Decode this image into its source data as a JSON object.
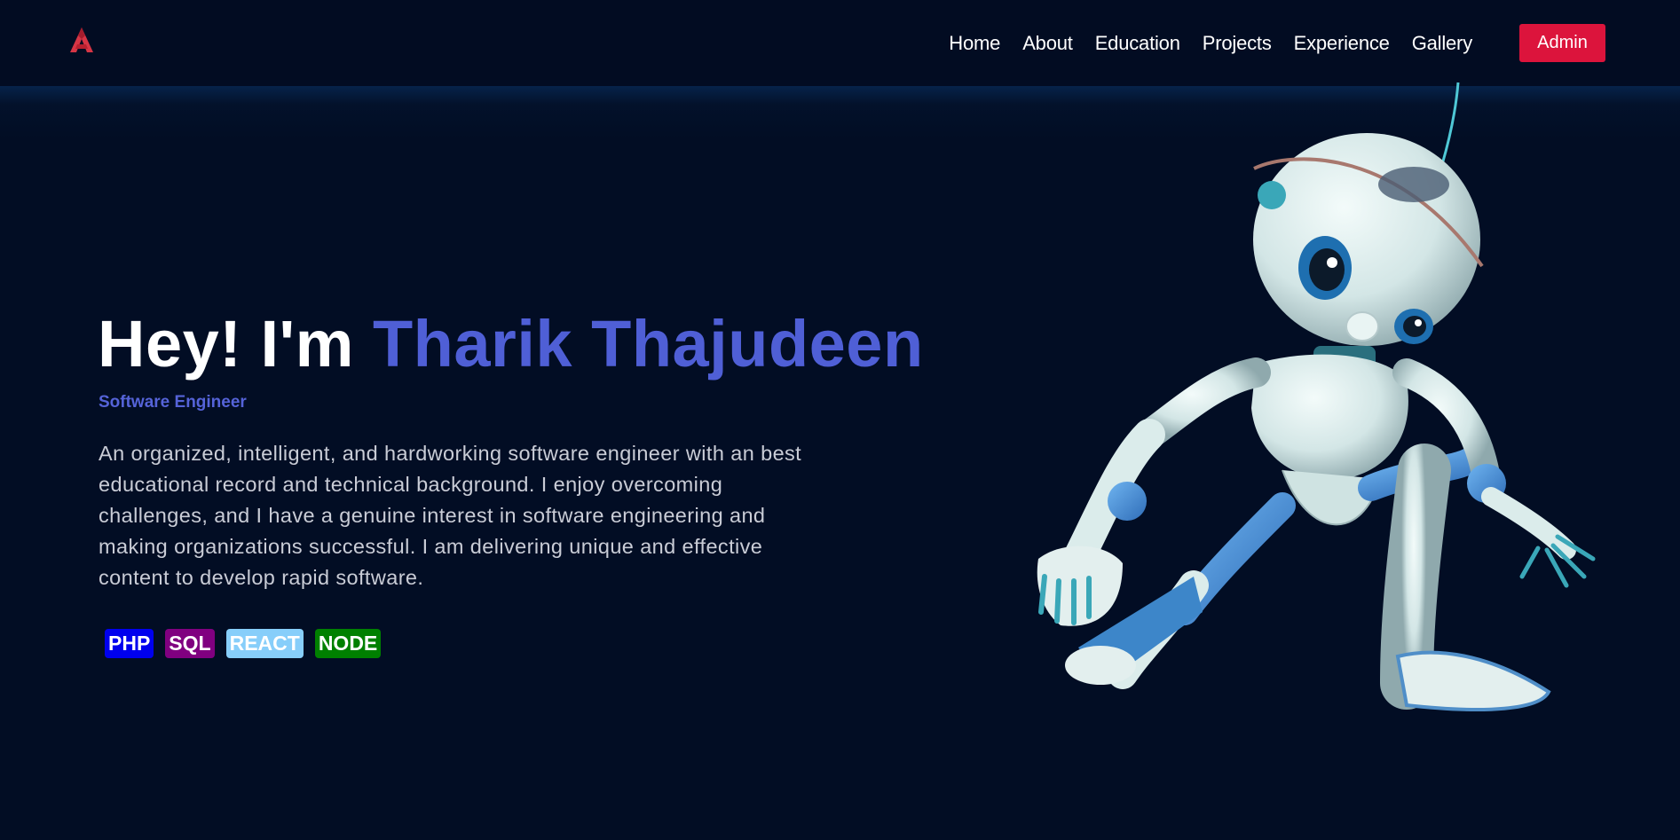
{
  "nav": {
    "logo_icon": "red-angular-a-logo",
    "links": [
      "Home",
      "About",
      "Education",
      "Projects",
      "Experience",
      "Gallery"
    ],
    "admin_label": "Admin",
    "admin_color": "#dc143c"
  },
  "hero": {
    "greeting": "Hey! I'm",
    "name": "Tharik Thajudeen",
    "name_color": "#4f5fd6",
    "subtitle": "Software Engineer",
    "description": "An organized, intelligent, and hardworking software engineer with an best educational record and technical background. I enjoy overcoming challenges, and I have a genuine interest in software engineering and making organizations successful. I am delivering unique and effective content to develop rapid software.",
    "skills": [
      {
        "label": "PHP",
        "color": "#0000ee"
      },
      {
        "label": "SQL",
        "color": "#800080"
      },
      {
        "label": "REACT",
        "color": "#87cefa"
      },
      {
        "label": "NODE",
        "color": "#008000"
      }
    ],
    "illustration": "white-blue-robot"
  },
  "colors": {
    "background": "#020d24",
    "navbar": "#020c22"
  }
}
